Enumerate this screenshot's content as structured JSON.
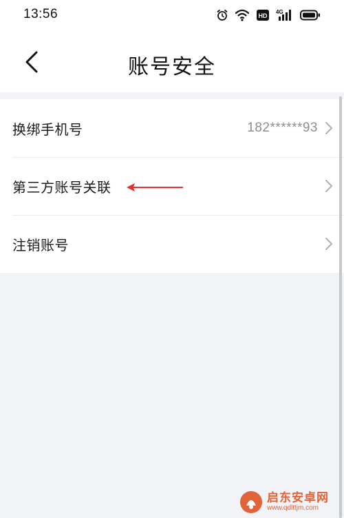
{
  "status_bar": {
    "time": "13:56",
    "hd_label": "HD",
    "network_label": "4G"
  },
  "header": {
    "title": "账号安全"
  },
  "settings": {
    "items": [
      {
        "label": "换绑手机号",
        "value": "182******93"
      },
      {
        "label": "第三方账号关联"
      },
      {
        "label": "注销账号"
      }
    ]
  },
  "watermark": {
    "name": "启东安卓网",
    "url": "www.qdlttjm.com"
  },
  "colors": {
    "annotation_arrow": "#e53030",
    "watermark": "#e0572a"
  }
}
